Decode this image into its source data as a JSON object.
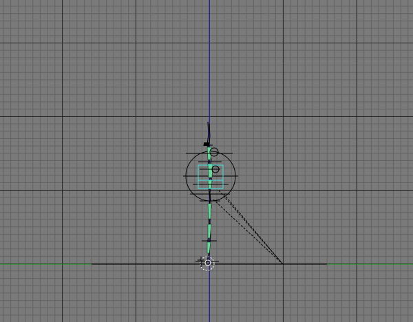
{
  "viewport": {
    "view": "front-orthographic",
    "grid_visible": true
  },
  "colors": {
    "background": "#7a7a7a",
    "grid_minor": "#626262",
    "grid_major": "#262626",
    "axis_vertical": "#2a2ad8",
    "axis_horizontal": "#1f9a1f",
    "rig_bone": "#000000",
    "mesh_segment": "#6fd39c",
    "selection": "#40e0e0",
    "gizmo": "#000000",
    "ik_target_line": "#000000",
    "ground_marker": "#ffffff"
  },
  "scene": {
    "objects": [
      {
        "name": "character-rig",
        "type": "armature",
        "segments": 14
      },
      {
        "name": "root-circle-control",
        "type": "control-circle"
      },
      {
        "name": "hip-selection-box",
        "type": "selection",
        "selected": true
      },
      {
        "name": "ik-target-dashed-lines",
        "type": "helper"
      },
      {
        "name": "ground-pivot-marker",
        "type": "helper"
      }
    ]
  }
}
